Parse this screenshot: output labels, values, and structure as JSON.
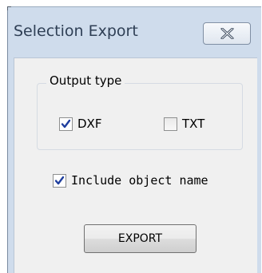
{
  "window": {
    "title": "Selection Export",
    "close_icon": "close-x-icon"
  },
  "output_type": {
    "label": "Output type",
    "options": [
      {
        "label": "DXF",
        "checked": true
      },
      {
        "label": "TXT",
        "checked": false
      }
    ]
  },
  "include_object_name": {
    "label": "Include object name",
    "checked": true
  },
  "export_button": {
    "label": "EXPORT"
  },
  "colors": {
    "frame": "#cfdcec",
    "client": "#f0f0f0",
    "check_mark": "#1f3e9e"
  }
}
